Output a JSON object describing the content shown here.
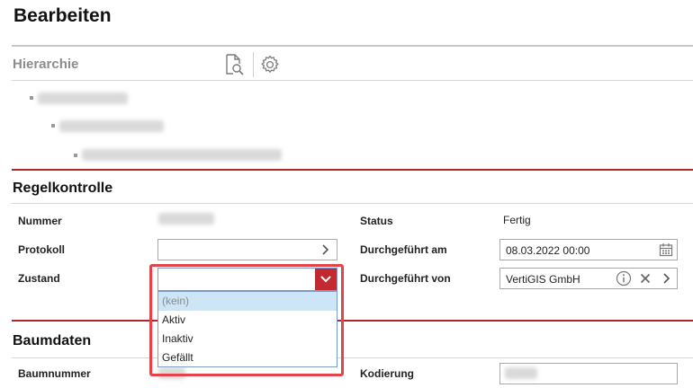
{
  "page": {
    "title": "Bearbeiten"
  },
  "hierarchy": {
    "title": "Hierarchie",
    "toolbar": {
      "search_icon": "document-search-icon",
      "settings_icon": "gear-icon"
    }
  },
  "regelkontrolle": {
    "title": "Regelkontrolle",
    "nummer_label": "Nummer",
    "protokoll_label": "Protokoll",
    "zustand_label": "Zustand",
    "status_label": "Status",
    "status_value": "Fertig",
    "durchgefuehrt_am_label": "Durchgeführt am",
    "durchgefuehrt_am_value": "08.03.2022 00:00",
    "durchgefuehrt_von_label": "Durchgeführt von",
    "durchgefuehrt_von_value": "VertiGIS GmbH"
  },
  "zustand_dropdown": {
    "value": "",
    "options": [
      "(kein)",
      "Aktiv",
      "Inaktiv",
      "Gefällt"
    ],
    "selected_index": 0
  },
  "baumdaten": {
    "title": "Baumdaten",
    "baumnummer_label": "Baumnummer",
    "kodierung_label": "Kodierung"
  },
  "colors": {
    "accent_red": "#c22a30",
    "highlight_red": "#e2444a",
    "selected_bg": "#cde6f7"
  }
}
